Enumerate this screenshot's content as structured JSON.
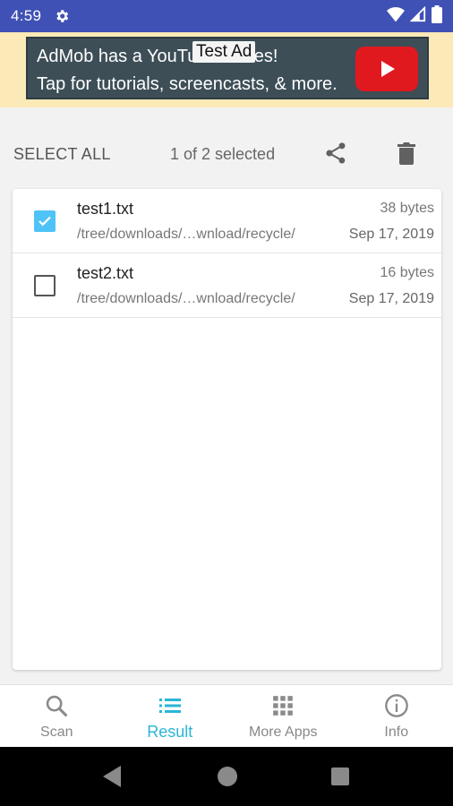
{
  "status_bar": {
    "time": "4:59"
  },
  "ad": {
    "line1": "AdMob has a YouTube Series!",
    "line2": "Tap for tutorials, screencasts, & more.",
    "tag": "Test Ad"
  },
  "toolbar": {
    "select_all_label": "SELECT ALL",
    "selection_count": "1 of 2 selected"
  },
  "files": [
    {
      "name": "test1.txt",
      "size": "38 bytes",
      "path": "/tree/downloads/…wnload/recycle/",
      "date": "Sep 17, 2019",
      "checked": true
    },
    {
      "name": "test2.txt",
      "size": "16 bytes",
      "path": "/tree/downloads/…wnload/recycle/",
      "date": "Sep 17, 2019",
      "checked": false
    }
  ],
  "bottom_nav": {
    "items": [
      {
        "label": "Scan",
        "icon": "search-icon",
        "active": false
      },
      {
        "label": "Result",
        "icon": "list-icon",
        "active": true
      },
      {
        "label": "More Apps",
        "icon": "apps-grid-icon",
        "active": false
      },
      {
        "label": "Info",
        "icon": "info-icon",
        "active": false
      }
    ]
  },
  "colors": {
    "status_bar": "#3f51b5",
    "accent": "#29b6d6",
    "checkbox_checked": "#4fc3f7",
    "ad_background": "#fbe9b7"
  }
}
